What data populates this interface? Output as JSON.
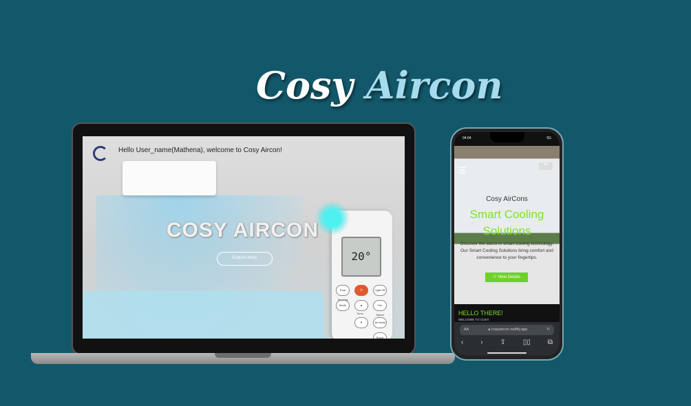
{
  "title": {
    "word1": "Cosy",
    "word2": "Aircon"
  },
  "laptop": {
    "greeting": "Hello User_name(Mathena), welcome to Cosy Aircon!",
    "hero": "COSY AIRCON",
    "explore_label": "Explore More",
    "remote": {
      "temp": "20°",
      "buttons": [
        "Dual Sensing",
        "Light Off",
        "Mode",
        "Fan Speed",
        "Temp",
        "Jet Mode",
        "Room Temp"
      ]
    }
  },
  "phone": {
    "time": "04:04",
    "signal": "5G",
    "brand": "Cosy AirCons",
    "headline": "Smart Cooling Solutions",
    "description": "Discover the latest in smart cooling technology. Our Smart Cooling Solutions bring comfort and convenience to your fingertips.",
    "view_label": "View Details",
    "hello": "HELLO THERE!",
    "welcome": "WELCOME TO COSY",
    "aa": "AA",
    "url": "cosyaircon.netlify.app"
  },
  "colors": {
    "background": "#13586a",
    "accent": "#7ee22a",
    "title_accent": "#a6dbee"
  }
}
